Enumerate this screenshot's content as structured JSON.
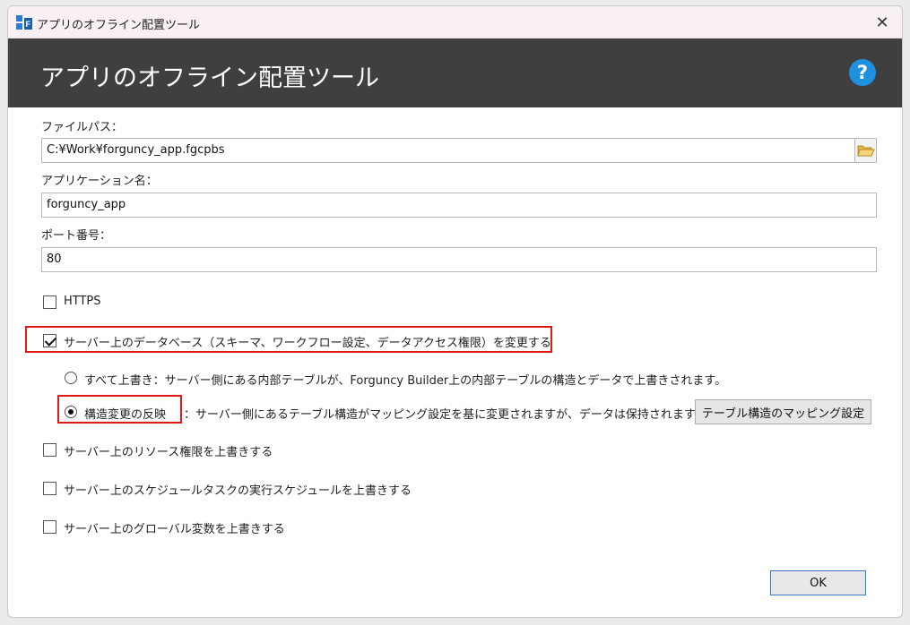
{
  "window": {
    "title": "アプリのオフライン配置ツール",
    "close_glyph": "✕"
  },
  "banner": {
    "title": "アプリのオフライン配置ツール",
    "help_glyph": "?",
    "help_color": "#1e90e0"
  },
  "form": {
    "file_path_label": "ファイルパス：",
    "file_path_value": "C:¥Work¥forguncy_app.fgcpbs",
    "app_name_label": "アプリケーション名：",
    "app_name_value": "forguncy_app",
    "port_label": "ポート番号：",
    "port_value": "80"
  },
  "options": {
    "https_label": "HTTPS",
    "https_checked": false,
    "db_change_label": "サーバー上のデータベース（スキーマ、ワークフロー設定、データアクセス権限）を変更する",
    "db_change_checked": true,
    "overwrite_all_label": "すべて上書き：サーバー側にある内部テーブルが、Forguncy Builder上の内部テーブルの構造とデータで上書きされます。",
    "reflect_label": "構造変更の反映",
    "reflect_desc": "：サーバー側にあるテーブル構造がマッピング設定を基に変更されますが、データは保持されます。",
    "mapping_button": "テーブル構造のマッピング設定",
    "resource_label": "サーバー上のリソース権限を上書きする",
    "schedule_label": "サーバー上のスケジュールタスクの実行スケジュールを上書きする",
    "global_label": "サーバー上のグローバル変数を上書きする"
  },
  "footer": {
    "ok_label": "OK"
  },
  "colors": {
    "highlight": "#e21818",
    "banner_bg": "#3f3f3f"
  }
}
